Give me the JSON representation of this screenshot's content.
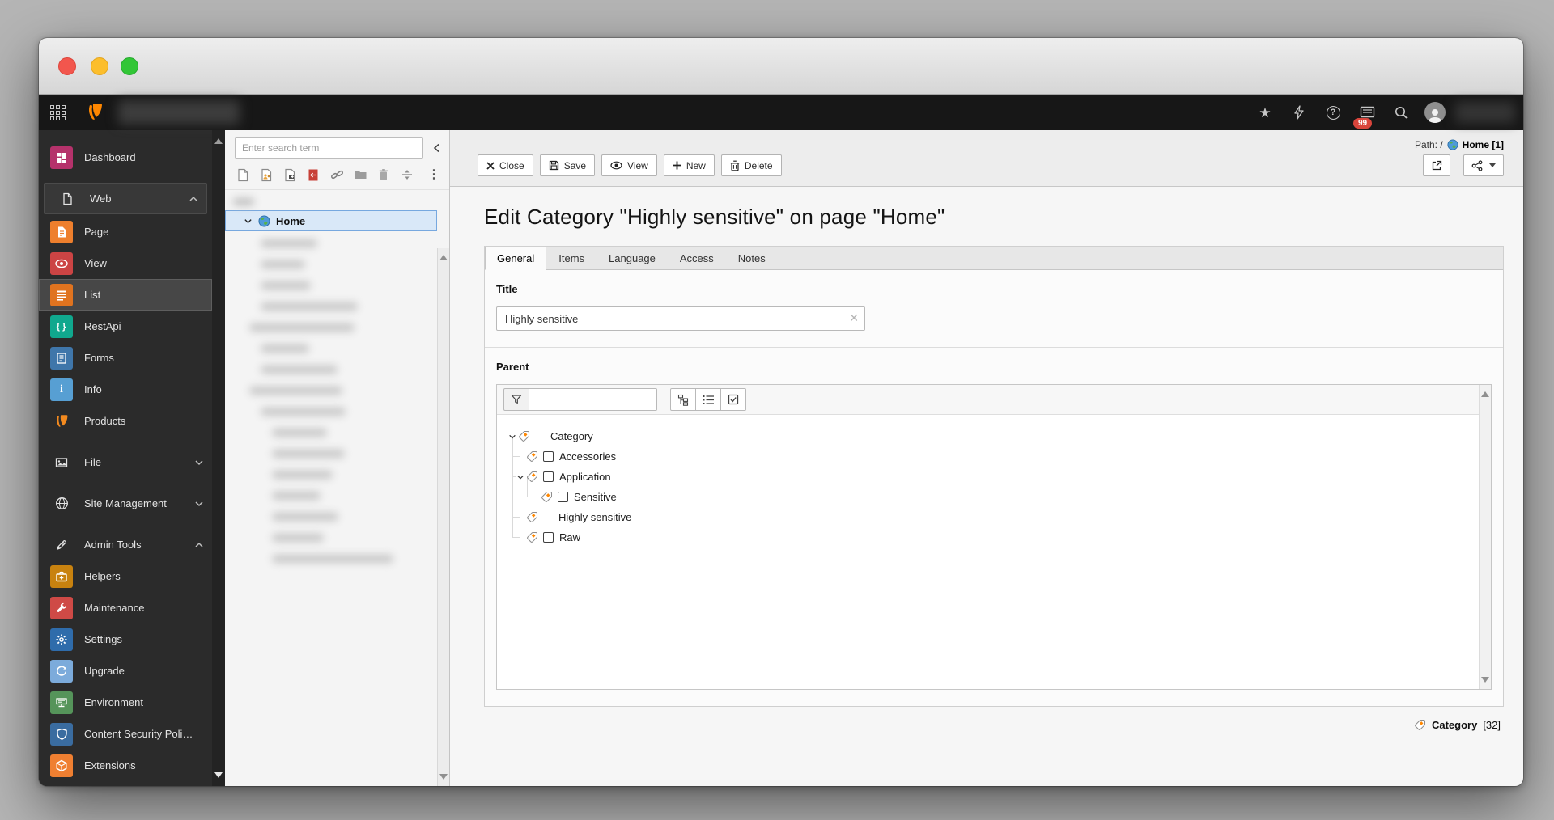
{
  "topbar": {
    "notification_badge": "99"
  },
  "module_menu": {
    "items": [
      {
        "label": "Dashboard"
      },
      {
        "label": "Web"
      },
      {
        "label": "Page"
      },
      {
        "label": "View"
      },
      {
        "label": "List"
      },
      {
        "label": "RestApi"
      },
      {
        "label": "Forms"
      },
      {
        "label": "Info"
      },
      {
        "label": "Products"
      },
      {
        "label": "File"
      },
      {
        "label": "Site Management"
      },
      {
        "label": "Admin Tools"
      },
      {
        "label": "Helpers"
      },
      {
        "label": "Maintenance"
      },
      {
        "label": "Settings"
      },
      {
        "label": "Upgrade"
      },
      {
        "label": "Environment"
      },
      {
        "label": "Content Security Poli…"
      },
      {
        "label": "Extensions"
      }
    ]
  },
  "pagetree": {
    "search_placeholder": "Enter search term",
    "selected_node": "Home"
  },
  "docheader": {
    "path_prefix": "Path: /",
    "path_page": "Home [1]",
    "buttons": [
      {
        "label": "Close"
      },
      {
        "label": "Save"
      },
      {
        "label": "View"
      },
      {
        "label": "New"
      },
      {
        "label": "Delete"
      }
    ]
  },
  "form": {
    "heading": "Edit Category \"Highly sensitive\" on page \"Home\"",
    "tabs": [
      {
        "label": "General"
      },
      {
        "label": "Items"
      },
      {
        "label": "Language"
      },
      {
        "label": "Access"
      },
      {
        "label": "Notes"
      }
    ],
    "active_tab": "General",
    "title_field": {
      "label": "Title",
      "value": "Highly sensitive"
    },
    "parent_field": {
      "label": "Parent",
      "tree": [
        {
          "label": "Category"
        },
        {
          "label": "Accessories"
        },
        {
          "label": "Application"
        },
        {
          "label": "Sensitive"
        },
        {
          "label": "Highly sensitive"
        },
        {
          "label": "Raw"
        }
      ]
    }
  },
  "footer": {
    "record_type": "Category",
    "record_count": "[32]"
  },
  "colors": {
    "accent": "#ff8700",
    "selection_bg": "#d9e8f8",
    "badge_red": "#d9453c"
  }
}
